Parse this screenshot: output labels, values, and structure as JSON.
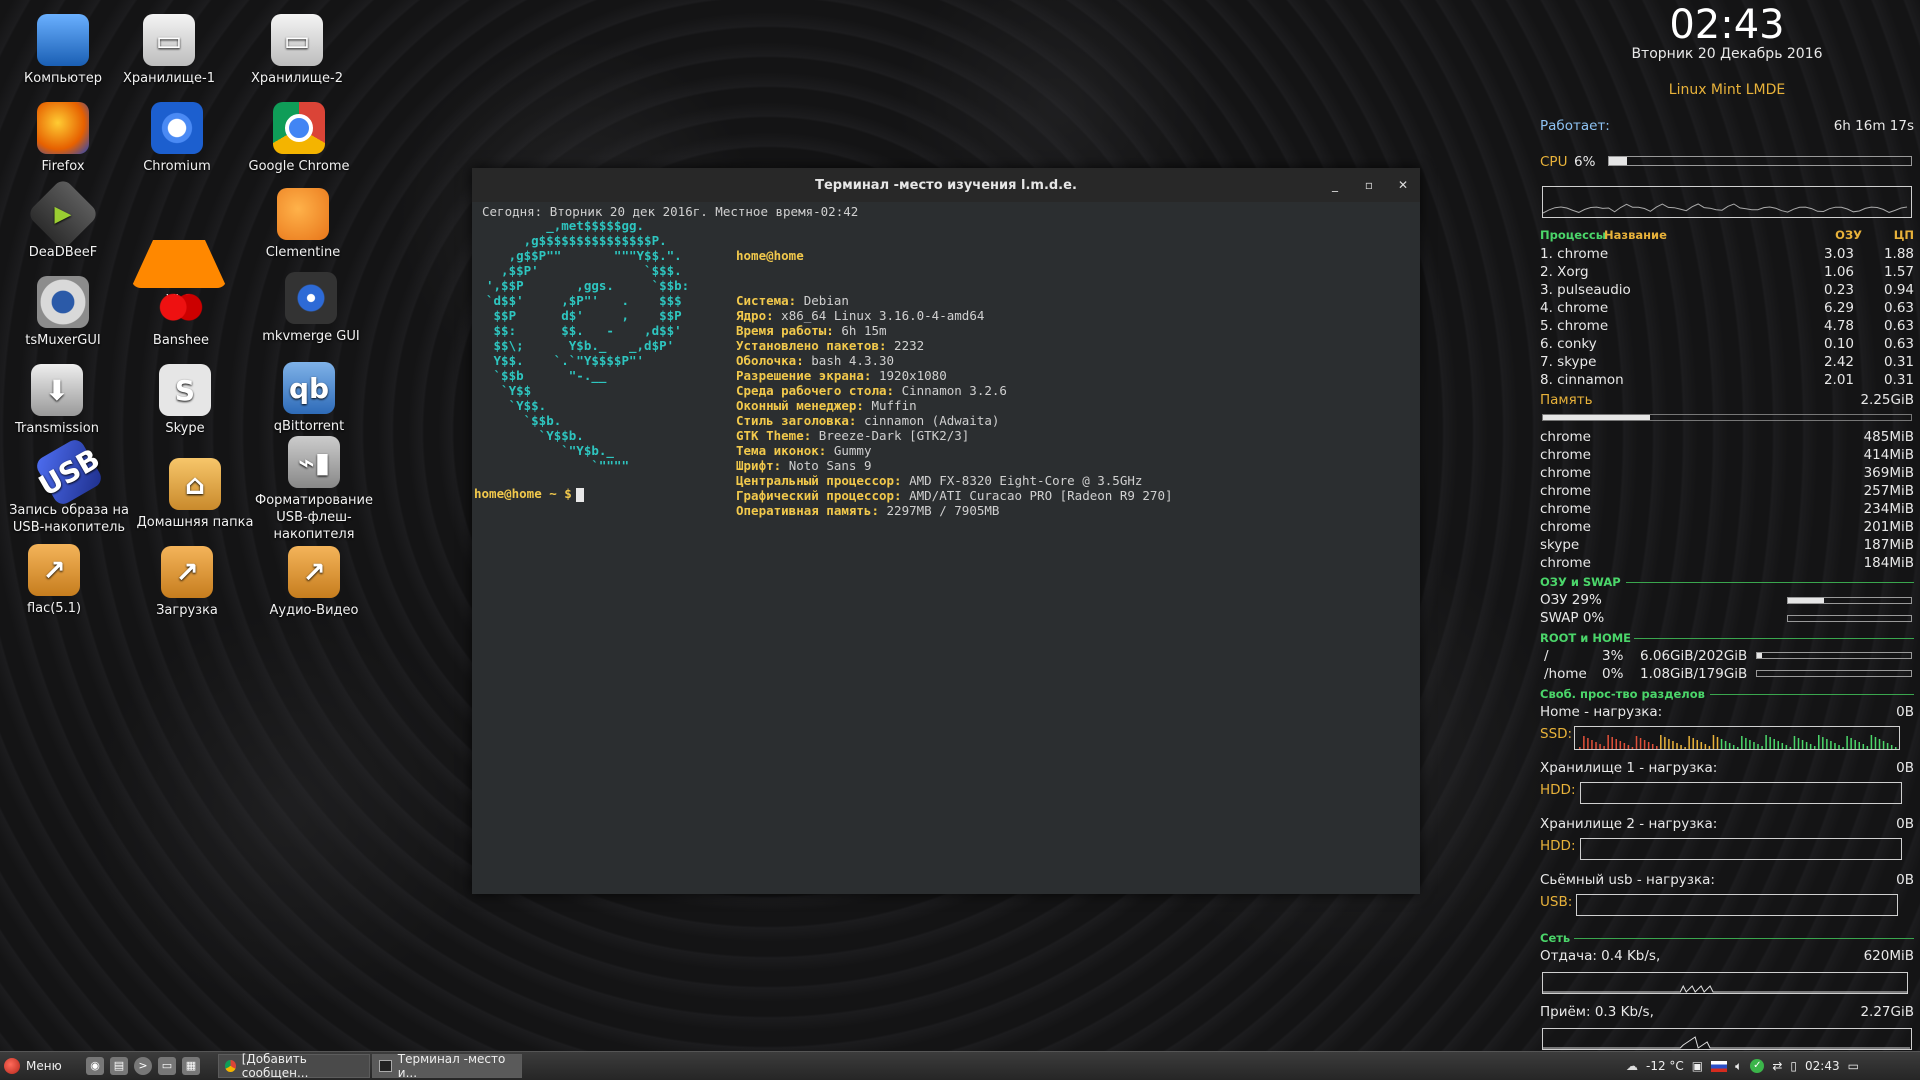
{
  "desktop_icons": [
    {
      "label": "Компьютер",
      "icon": "computer-icon"
    },
    {
      "label": "Хранилище-1",
      "icon": "drive-icon"
    },
    {
      "label": "Хранилище-2",
      "icon": "drive-icon"
    },
    {
      "label": "Firefox",
      "icon": "firefox-icon"
    },
    {
      "label": "Chromium",
      "icon": "chromium-icon"
    },
    {
      "label": "Google Chrome",
      "icon": "chrome-icon"
    },
    {
      "label": "DeaDBeeF",
      "icon": "deadbeef-icon"
    },
    {
      "label": "VLC",
      "icon": "vlc-icon"
    },
    {
      "label": "Clementine",
      "icon": "clementine-icon"
    },
    {
      "label": "tsMuxerGUI",
      "icon": "tsmuxer-icon"
    },
    {
      "label": "Banshee",
      "icon": "banshee-icon"
    },
    {
      "label": "mkvmerge GUI",
      "icon": "mkvmerge-icon"
    },
    {
      "label": "Transmission",
      "icon": "transmission-icon"
    },
    {
      "label": "Skype",
      "icon": "skype-icon"
    },
    {
      "label": "qBittorrent",
      "icon": "qbittorrent-icon"
    },
    {
      "label": "Запись образа на USB-накопитель",
      "icon": "usb-writer-icon"
    },
    {
      "label": "Домашняя папка",
      "icon": "home-folder-icon"
    },
    {
      "label": "Форматирование USB-флеш-накопителя",
      "icon": "usb-format-icon"
    },
    {
      "label": "flac(5.1)",
      "icon": "folder-link-icon"
    },
    {
      "label": "Загрузка",
      "icon": "folder-link-icon"
    },
    {
      "label": "Аудио-Видео",
      "icon": "folder-link-icon"
    }
  ],
  "terminal": {
    "title": "Терминал -место изучения l.m.d.e.",
    "header_line": "Сегодня: Вторник 20 дек 2016г. Местное время-02:42",
    "logo": "        _,met$$$$$gg.\n     ,g$$$$$$$$$$$$$$$P.\n   ,g$$P\"\"       \"\"\"Y$$.\".\n  ,$$P'              `$$$.\n',$$P       ,ggs.     `$$b:\n`d$$'     ,$P\"'   .    $$$\n $$P      d$'     ,    $$P\n $$:      $$.   -    ,d$$'\n $$\\;      Y$b._   _,d$P'\n Y$$.    `.`\"Y$$$$P\"'\n `$$b      \"-.__\n  `Y$$\n   `Y$$.\n     `$$b.\n       `Y$$b.\n          `\"Y$b._\n              `\"\"\"\"",
    "host": "home@home",
    "info": [
      {
        "key": "Система:",
        "value": "Debian"
      },
      {
        "key": "Ядро:",
        "value": "x86_64 Linux 3.16.0-4-amd64"
      },
      {
        "key": "Время работы:",
        "value": "6h 15m"
      },
      {
        "key": "Установлено пакетов:",
        "value": "2232"
      },
      {
        "key": "Оболочка:",
        "value": "bash 4.3.30"
      },
      {
        "key": "Разрешение экрана:",
        "value": "1920x1080"
      },
      {
        "key": "Среда рабочего стола:",
        "value": "Cinnamon 3.2.6"
      },
      {
        "key": "Оконный менеджер:",
        "value": "Muffin"
      },
      {
        "key": "Стиль заголовка:",
        "value": "cinnamon (Adwaita)"
      },
      {
        "key": "GTK Theme:",
        "value": "Breeze-Dark [GTK2/3]"
      },
      {
        "key": "Тема иконок:",
        "value": "Gummy"
      },
      {
        "key": "Шрифт:",
        "value": "Noto Sans 9"
      },
      {
        "key": "Центральный процессор:",
        "value": "AMD FX-8320 Eight-Core @ 3.5GHz"
      },
      {
        "key": "Графический процессор:",
        "value": "AMD/ATI Curacao PRO [Radeon R9 270]"
      },
      {
        "key": "Оперативная память:",
        "value": "2297MB / 7905MB"
      }
    ],
    "prompt_user": "home@home ~ $"
  },
  "conky": {
    "time": "02:43",
    "date": "Вторник 20 Декабрь 2016",
    "distro": "Linux Mint LMDE",
    "uptime_label": "Работает:",
    "uptime_value": "6h 16m 17s",
    "cpu_label": "CPU",
    "cpu_percent_text": "6%",
    "cpu_percent": 6,
    "proc_header": {
      "a": "Процессы",
      "b": "Название",
      "mem": "ОЗУ",
      "cpu": "ЦП"
    },
    "processes": [
      {
        "name": "1. chrome",
        "mem": "3.03",
        "cpu": "1.88"
      },
      {
        "name": "2. Xorg",
        "mem": "1.06",
        "cpu": "1.57"
      },
      {
        "name": "3. pulseaudio",
        "mem": "0.23",
        "cpu": "0.94"
      },
      {
        "name": "4. chrome",
        "mem": "6.29",
        "cpu": "0.63"
      },
      {
        "name": "5. chrome",
        "mem": "4.78",
        "cpu": "0.63"
      },
      {
        "name": "6. conky",
        "mem": "0.10",
        "cpu": "0.63"
      },
      {
        "name": "7. skype",
        "mem": "2.42",
        "cpu": "0.31"
      },
      {
        "name": "8. cinnamon",
        "mem": "2.01",
        "cpu": "0.31"
      }
    ],
    "memory_label": "Память",
    "memory_value": "2.25GiB",
    "memory_fraction": 0.29,
    "mem_procs": [
      {
        "name": "chrome",
        "value": "485MiB"
      },
      {
        "name": "chrome",
        "value": "414MiB"
      },
      {
        "name": "chrome",
        "value": "369MiB"
      },
      {
        "name": "chrome",
        "value": "257MiB"
      },
      {
        "name": "chrome",
        "value": "234MiB"
      },
      {
        "name": "chrome",
        "value": "201MiB"
      },
      {
        "name": "skype",
        "value": "187MiB"
      },
      {
        "name": "chrome",
        "value": "184MiB"
      }
    ],
    "ram_swap_title": "ОЗУ и SWAP",
    "ram_label": "ОЗУ  29%",
    "ram_percent": 29,
    "swap_label": "SWAP 0%",
    "swap_percent": 0,
    "root_home_title": "ROOT и HOME",
    "root": {
      "mount": "/",
      "percent_text": "3%",
      "usage": "6.06GiB/202GiB",
      "percent": 3
    },
    "home": {
      "mount": "/home",
      "percent_text": "0%",
      "usage": "1.08GiB/179GiB",
      "percent": 0
    },
    "free_space_title": "Своб. прос-тво разделов",
    "disks": [
      {
        "label": "Home - нагрузка:",
        "value": "0B",
        "type": "SSD:"
      },
      {
        "label": "Хранилище 1 - нагрузка:",
        "value": "0B",
        "type": "HDD:"
      },
      {
        "label": "Хранилище 2 - нагрузка:",
        "value": "0B",
        "type": "HDD:"
      },
      {
        "label": "Сьёмный usb - нагрузка:",
        "value": "0B",
        "type": "USB:"
      }
    ],
    "net_title": "Сеть",
    "upload_label": "Отдача: 0.4 Kb/s,",
    "upload_total": "620MiB",
    "download_label": "Приём: 0.3 Kb/s,",
    "download_total": "2.27GiB"
  },
  "taskbar": {
    "menu_label": "Меню",
    "tasks": [
      {
        "label": "[Добавить сообщен...",
        "icon": "chrome-icon"
      },
      {
        "label": "Терминал -место и...",
        "icon": "terminal-icon"
      }
    ],
    "weather": "-12 °C",
    "clock": "02:43"
  }
}
